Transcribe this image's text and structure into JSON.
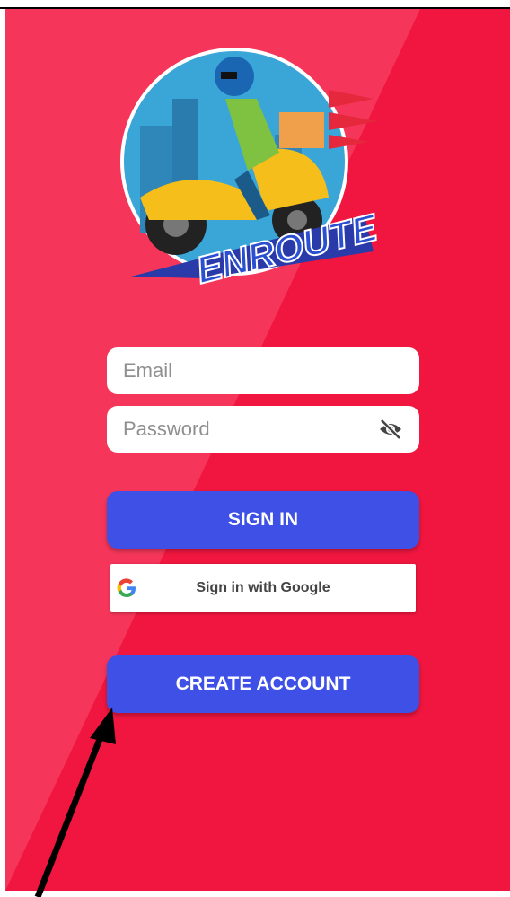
{
  "login": {
    "email_placeholder": "Email",
    "password_placeholder": "Password",
    "sign_in_label": "SIGN IN",
    "google_label": "Sign in with Google",
    "create_account_label": "CREATE ACCOUNT"
  },
  "brand": {
    "logo_text": "ENROUTE"
  },
  "icons": {
    "password_toggle": "eye-off-icon",
    "google": "google-g-icon",
    "annotation": "arrow-icon"
  },
  "colors": {
    "background": "#f0163f",
    "button": "#3f50e6",
    "field": "#ffffff"
  }
}
